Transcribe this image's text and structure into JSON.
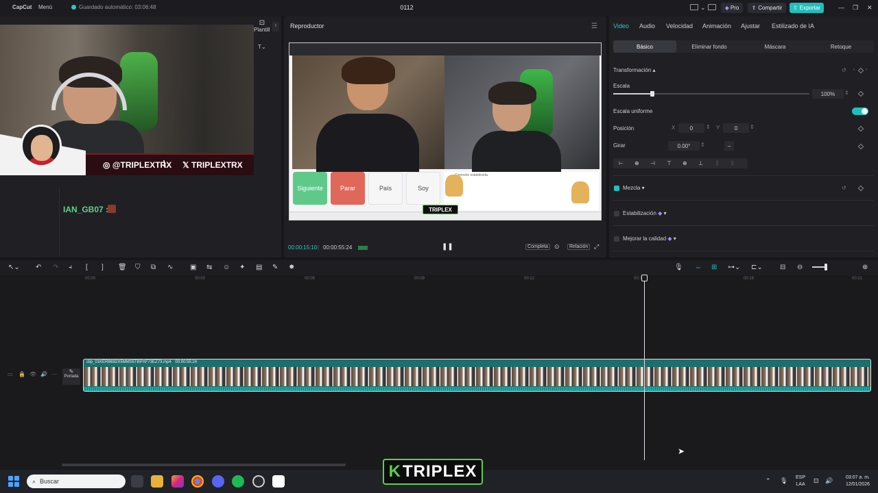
{
  "app": {
    "name": "CapCut",
    "menu": "Menú",
    "autosave": "Guardado automático: 03:06:48",
    "project_title": "0112",
    "pro": "Pro",
    "share": "Compartir",
    "export": "Exportar"
  },
  "left_panel": {
    "templates_tab": "Plantillas",
    "text_btn": "T",
    "overlay": {
      "instagram": "@TRIPLEXTRX",
      "separator": "\\",
      "x_handle": "TRIPLEXTRX"
    },
    "chat_line": "IAN_GB07 :"
  },
  "player": {
    "title": "Reproductor",
    "buttons": [
      "Siguiente",
      "Parar",
      "País",
      "Soy"
    ],
    "connection_text": "Conexión establecida.",
    "stream_logo": "TRIPLEX",
    "time_current": "00:00:15:10",
    "time_total": "00:00:55:24",
    "full_label": "Completa",
    "ratio_label": "Relación"
  },
  "right_panel": {
    "tabs": [
      "Video",
      "Audio",
      "Velocidad",
      "Animación",
      "Ajustar",
      "Estilizado de IA"
    ],
    "subtabs": [
      "Básico",
      "Eliminar fondo",
      "Máscara",
      "Retoque"
    ],
    "transform_title": "Transformación",
    "scale_label": "Escala",
    "scale_value": "100%",
    "scale_fraction": 0.2,
    "uniform_label": "Escala uniforme",
    "position_label": "Posición",
    "x_label": "X",
    "x_value": "0",
    "y_label": "Y",
    "y_value": "0",
    "rotate_label": "Girar",
    "rotate_value": "0.00°",
    "blend_label": "Mezcla",
    "stabilize_label": "Estabilización",
    "enhance_label": "Mejorar la calidad"
  },
  "timeline": {
    "ticks": [
      "00:00",
      "00:03",
      "00:06",
      "00:09",
      "00:12",
      "00:15",
      "00:18",
      "00:21"
    ],
    "cover_label": "Portada",
    "clip_name": "clip_01KERB692X5MMS5TBPXF73EZ73.mp4",
    "clip_duration": "00:00:55:24"
  },
  "taskbar": {
    "search_placeholder": "Buscar",
    "center_logo": "TRIPLEX",
    "lang_top": "ESP",
    "lang_bottom": "LAA",
    "time": "03:07 a. m.",
    "date": "12/01/2026"
  },
  "colors": {
    "accent": "#1fc0bd",
    "clip": "#1c6f6c",
    "next": "#5fc98a",
    "stop": "#e0685a"
  }
}
